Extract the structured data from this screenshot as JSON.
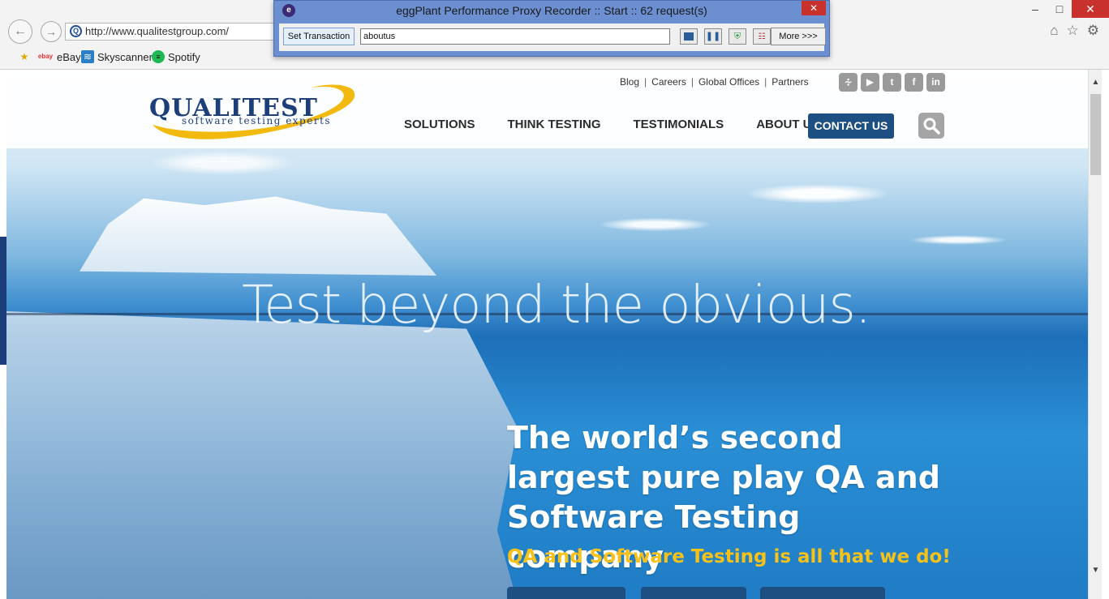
{
  "browser": {
    "url": "http://www.qualitestgroup.com/",
    "favorites": [
      {
        "label": "",
        "icon": "favorites-star-icon"
      },
      {
        "label": "eBay",
        "icon": "ebay-icon"
      },
      {
        "label": "Skyscanner",
        "icon": "skyscanner-icon"
      },
      {
        "label": "Spotify",
        "icon": "spotify-icon"
      }
    ],
    "window_controls": {
      "minimize": "–",
      "maximize": "□",
      "close": "✕"
    }
  },
  "recorder": {
    "title": "eggPlant Performance Proxy Recorder :: Start :: 62 request(s)",
    "set_transaction_label": "Set Transaction",
    "transaction_value": "aboutus",
    "more_label": "More >>>",
    "close_label": "✕"
  },
  "site": {
    "logo_text": "QUALITEST",
    "logo_tagline": "software testing experts",
    "toplinks": [
      "Blog",
      "Careers",
      "Global Offices",
      "Partners"
    ],
    "social": [
      "rss",
      "youtube",
      "twitter",
      "facebook",
      "linkedin"
    ],
    "nav": [
      "SOLUTIONS",
      "THINK TESTING",
      "TESTIMONIALS",
      "ABOUT US"
    ],
    "contact_label": "CONTACT US",
    "tagline": "Test beyond the obvious.",
    "headline": "The world’s second largest pure play QA and Software Testing company",
    "subheadline": "QA and Software Testing is all that we do!"
  },
  "colors": {
    "brand_navy": "#1d4f82",
    "accent_yellow": "#f6c21a",
    "recorder_frame": "#6b8fd1",
    "close_red": "#c9312c"
  }
}
